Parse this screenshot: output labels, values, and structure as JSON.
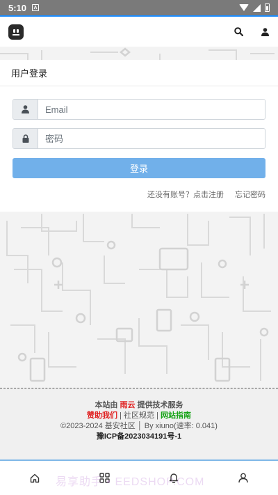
{
  "status_bar": {
    "time": "5:10",
    "notification_glyph": "A"
  },
  "header": {
    "logo_icon": "robot-face-icon",
    "search_icon": "search-icon",
    "user_icon": "user-icon",
    "accent_color": "#1a8cff"
  },
  "login": {
    "title": "用户登录",
    "email_placeholder": "Email",
    "password_placeholder": "密码",
    "submit_label": "登录",
    "register_link": "还没有账号？点击注册",
    "forgot_link": "忘记密码",
    "button_color": "#71b0ea"
  },
  "footer": {
    "line1_prefix": "本站由",
    "line1_brand": "雨云",
    "line1_suffix": "提供技术服务",
    "donate": "赞助我们",
    "sep1": "|",
    "rules": "社区规范",
    "sep2": "|",
    "guide": "网站指南",
    "line3": "©2023-2024 基安社区 │ By xiuno(速率: 0.041)",
    "icp": "豫ICP备2023034191号-1"
  },
  "bottom_nav": {
    "items": [
      "home-icon",
      "grid-icon",
      "bell-icon",
      "profile-icon"
    ]
  },
  "watermark": "易享助手 • EEDSHOP.COM"
}
